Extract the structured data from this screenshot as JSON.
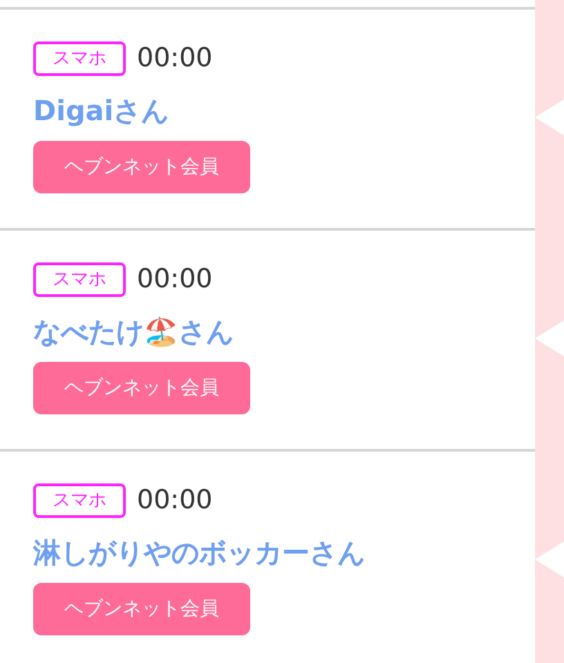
{
  "messages": [
    {
      "device": "スマホ",
      "time": "00:00",
      "name": "Digaiさん",
      "badge": "ヘブンネット会員"
    },
    {
      "device": "スマホ",
      "time": "00:00",
      "name": "なべたけ🏖️さん",
      "badge": "ヘブンネット会員"
    },
    {
      "device": "スマホ",
      "time": "00:00",
      "name": "淋しがりやのボッカーさん",
      "badge": "ヘブンネット会員"
    }
  ]
}
